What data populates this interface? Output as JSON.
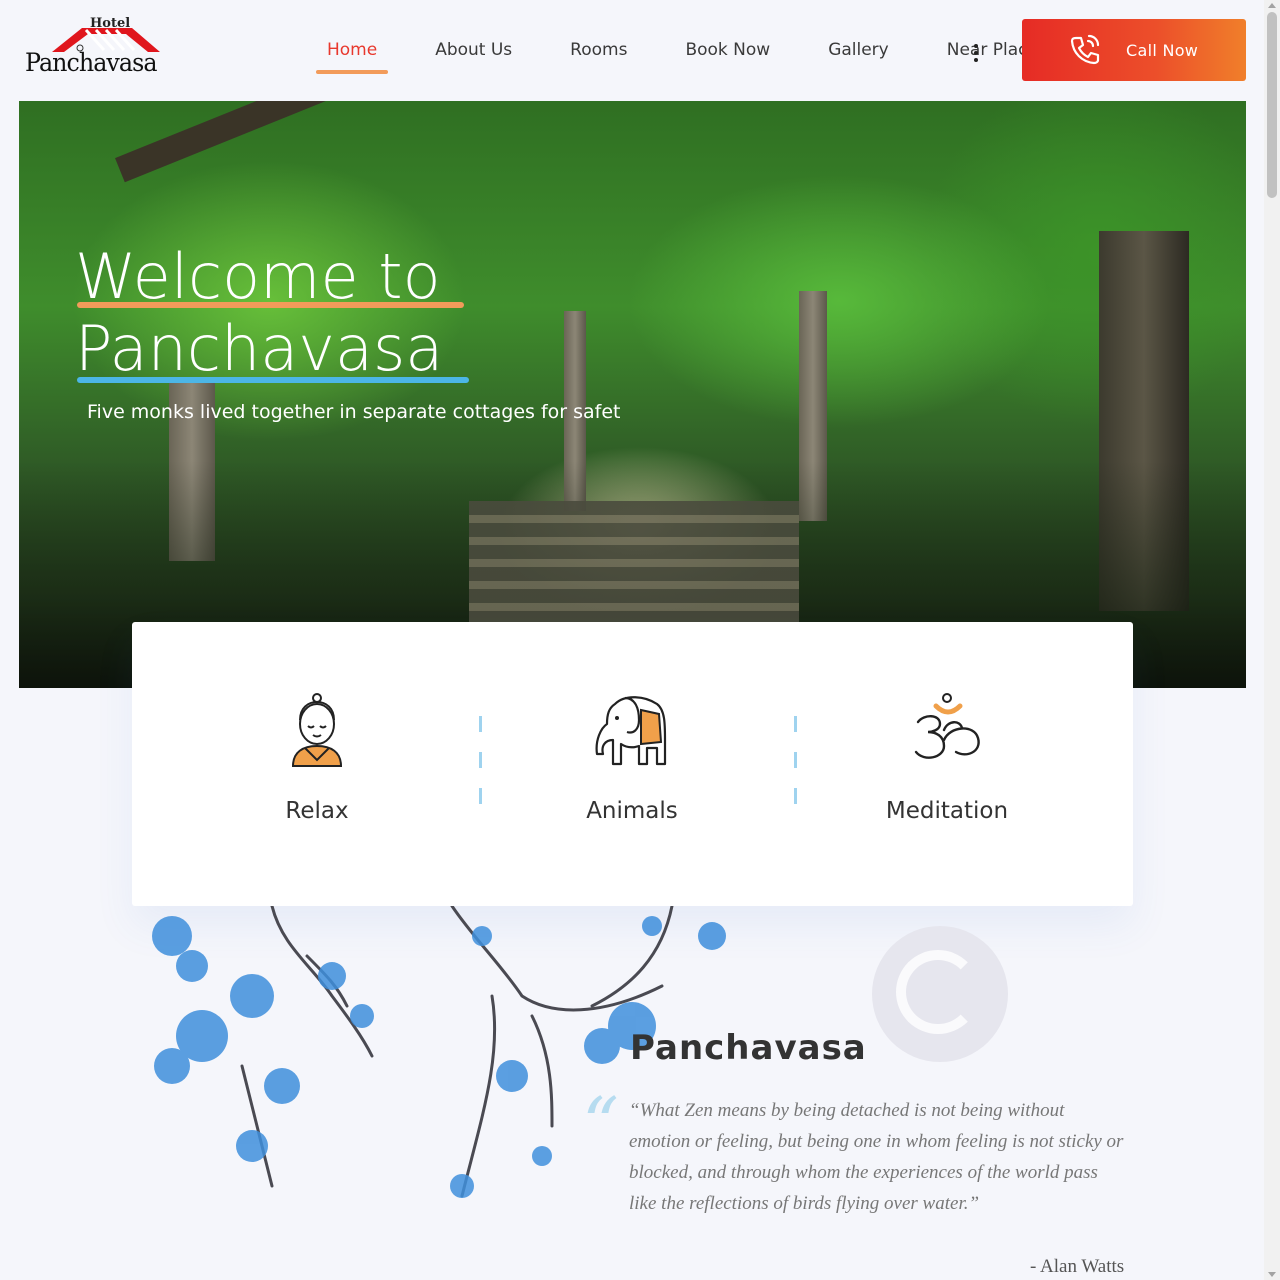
{
  "logo": {
    "small_text": "Hotel",
    "name": "Panchavasa"
  },
  "nav": {
    "items": [
      {
        "label": "Home",
        "active": true
      },
      {
        "label": "About Us",
        "active": false
      },
      {
        "label": "Rooms",
        "active": false
      },
      {
        "label": "Book Now",
        "active": false
      },
      {
        "label": "Gallery",
        "active": false
      },
      {
        "label": "Near Places",
        "active": false
      }
    ],
    "more_icon": "vertical-dots-icon",
    "call_button": {
      "label": "Call Now",
      "icon": "phone-ringing-icon"
    }
  },
  "hero": {
    "title_line1": "Welcome to",
    "title_line2": "Panchavasa",
    "subtitle": "Five monks lived together in separate cottages for safet"
  },
  "features": [
    {
      "label": "Relax",
      "icon": "buddha-icon"
    },
    {
      "label": "Animals",
      "icon": "elephant-icon"
    },
    {
      "label": "Meditation",
      "icon": "om-icon"
    }
  ],
  "about": {
    "title": "Panchavasa",
    "quote": "“What Zen means by being detached is not being without emotion or feeling, but being one in whom feeling is not sticky or blocked, and through whom the experiences of the world pass like the reflections of birds flying over water.”",
    "author": "- Alan Watts"
  },
  "colors": {
    "accent_red": "#e8382d",
    "accent_orange": "#f29b5a",
    "accent_blue": "#4cb6e6",
    "background": "#f5f6fb"
  }
}
